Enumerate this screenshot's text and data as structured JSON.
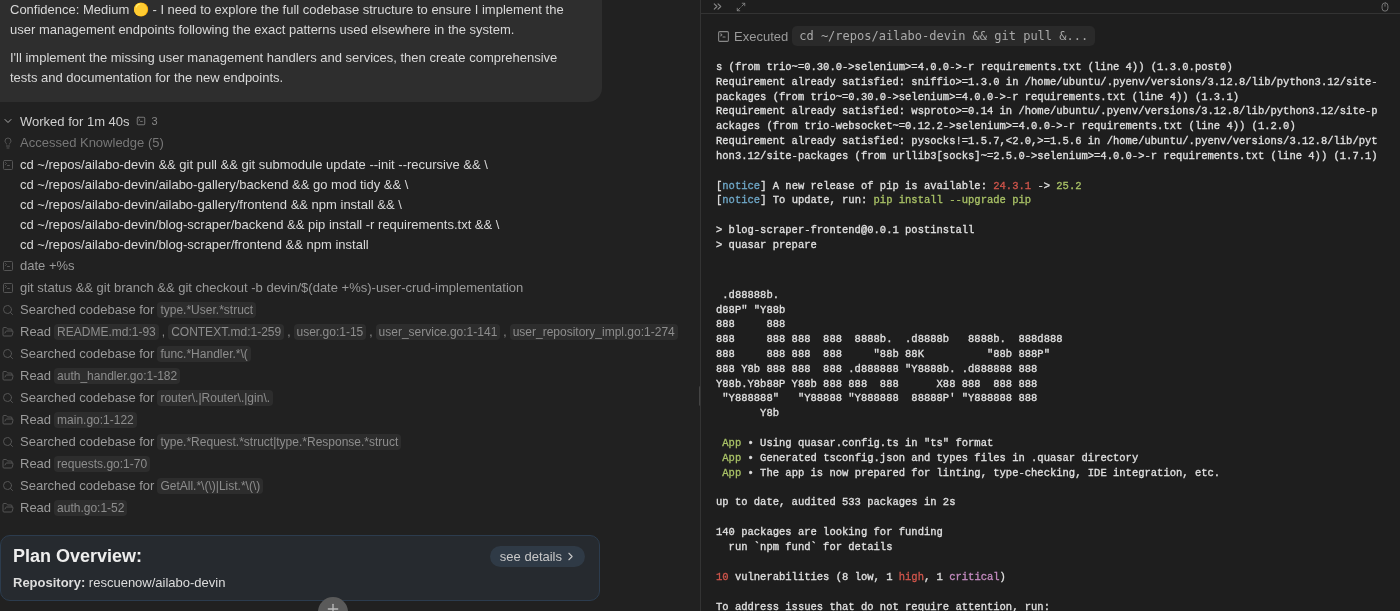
{
  "message": {
    "paragraphs": [
      "Confidence: Medium 🟡 - I need to explore the full codebase structure to ensure I implement the user management endpoints following the exact patterns used elsewhere in the system.",
      "I'll implement the missing user management handlers and services, then create comprehensive tests and documentation for the new endpoints."
    ]
  },
  "worklog": {
    "title": "Worked for 1m 40s",
    "command_count": "3",
    "expanded": true,
    "items": [
      {
        "kind": "knowledge",
        "text": "Accessed Knowledge (5)"
      },
      {
        "kind": "command",
        "lines": [
          "cd ~/repos/ailabo-devin && git pull && git submodule update --init --recursive && \\",
          "cd ~/repos/ailabo-devin/ailabo-gallery/backend && go mod tidy && \\",
          "cd ~/repos/ailabo-devin/ailabo-gallery/frontend && npm install && \\",
          "cd ~/repos/ailabo-devin/blog-scraper/backend && pip install -r requirements.txt && \\",
          "cd ~/repos/ailabo-devin/blog-scraper/frontend && npm install"
        ]
      },
      {
        "kind": "command",
        "lines": [
          "date +%s"
        ]
      },
      {
        "kind": "command",
        "lines": [
          "git status && git branch && git checkout -b devin/$(date +%s)-user-crud-implementation"
        ]
      },
      {
        "kind": "search",
        "text": "Searched codebase for",
        "chips": [
          "type.*User.*struct"
        ]
      },
      {
        "kind": "read",
        "text": "Read",
        "separator": ",",
        "chips": [
          "README.md:1-93",
          "CONTEXT.md:1-259",
          "user.go:1-15",
          "user_service.go:1-141",
          "user_repository_impl.go:1-274"
        ]
      },
      {
        "kind": "search",
        "text": "Searched codebase for",
        "chips": [
          "func.*Handler.*\\("
        ]
      },
      {
        "kind": "read",
        "text": "Read",
        "chips": [
          "auth_handler.go:1-182"
        ]
      },
      {
        "kind": "search",
        "text": "Searched codebase for",
        "chips": [
          "router\\.|Router\\.|gin\\."
        ]
      },
      {
        "kind": "read",
        "text": "Read",
        "chips": [
          "main.go:1-122"
        ]
      },
      {
        "kind": "search",
        "text": "Searched codebase for",
        "chips": [
          "type.*Request.*struct|type.*Response.*struct"
        ]
      },
      {
        "kind": "read",
        "text": "Read",
        "chips": [
          "requests.go:1-70"
        ]
      },
      {
        "kind": "search",
        "text": "Searched codebase for",
        "chips": [
          "GetAll.*\\(\\)|List.*\\(\\)"
        ]
      },
      {
        "kind": "read",
        "text": "Read",
        "chips": [
          "auth.go:1-52"
        ]
      }
    ]
  },
  "plan": {
    "title": "Plan Overview:",
    "details_button": "see details",
    "repository_label": "Repository:",
    "repository": "rescuenow/ailabo-devin"
  },
  "terminal": {
    "executed_label": "Executed",
    "command": "cd ~/repos/ailabo-devin && git pull &...",
    "blocks": [
      {
        "kind": "text",
        "lines": [
          [
            {
              "text": "s (from trio~=0.30.0->selenium>=4.0.0->-r requirements.txt (line 4)) (1.3.0.post0)"
            }
          ],
          [
            {
              "text": "Requirement already satisfied: sniffio>=1.3.0 in /home/ubuntu/.pyenv/versions/3.12.8/lib/python3.12/site-"
            }
          ],
          [
            {
              "text": "packages (from trio~=0.30.0->selenium>=4.0.0->-r requirements.txt (line 4)) (1.3.1)"
            }
          ],
          [
            {
              "text": "Requirement already satisfied: wsproto>=0.14 in /home/ubuntu/.pyenv/versions/3.12.8/lib/python3.12/site-p"
            }
          ],
          [
            {
              "text": "ackages (from trio-websocket~=0.12.2->selenium>=4.0.0->-r requirements.txt (line 4)) (1.2.0)"
            }
          ],
          [
            {
              "text": "Requirement already satisfied: pysocks!=1.5.7,<2.0,>=1.5.6 in /home/ubuntu/.pyenv/versions/3.12.8/lib/pyt"
            }
          ],
          [
            {
              "text": "hon3.12/site-packages (from urllib3[socks]~=2.5.0->selenium>=4.0.0->-r requirements.txt (line 4)) (1.7.1)"
            }
          ]
        ]
      },
      {
        "kind": "text",
        "lines": [
          [
            {
              "text": "["
            },
            {
              "text": "notice",
              "color": "#6fa8c8"
            },
            {
              "text": "] A new release of pip is available: "
            },
            {
              "text": "24.3.1",
              "color": "#d0554b"
            },
            {
              "text": " -> "
            },
            {
              "text": "25.2",
              "color": "#a9c266"
            }
          ],
          [
            {
              "text": "["
            },
            {
              "text": "notice",
              "color": "#6fa8c8"
            },
            {
              "text": "] To update, run: "
            },
            {
              "text": "pip install --upgrade pip",
              "color": "#a9c266"
            }
          ]
        ]
      },
      {
        "kind": "text",
        "lines": [
          [
            {
              "text": "> blog-scraper-frontend@0.0.1 postinstall"
            }
          ],
          [
            {
              "text": "> quasar prepare"
            }
          ]
        ]
      },
      {
        "kind": "ascii",
        "lines": [
          [
            {
              "text": " .d88888b."
            }
          ],
          [
            {
              "text": "d88P\" \"Y88b"
            }
          ],
          [
            {
              "text": "888     888"
            }
          ],
          [
            {
              "text": "888     888 888  888  8888b.  .d8888b   8888b.  888d888"
            }
          ],
          [
            {
              "text": "888     888 888  888     \"88b 88K          \"88b 888P\""
            }
          ],
          [
            {
              "text": "888 Y8b 888 888  888 .d888888 \"Y8888b. .d888888 888"
            }
          ],
          [
            {
              "text": "Y88b.Y8b88P Y88b 888 888  888      X88 888  888 888"
            }
          ],
          [
            {
              "text": " \"Y888888\"   \"Y88888 \"Y888888  88888P' \"Y888888 888"
            }
          ],
          [
            {
              "text": "       Y8b"
            }
          ]
        ]
      },
      {
        "kind": "text",
        "lines": [
          [
            {
              "text": " App",
              "color": "#a9c266"
            },
            {
              "text": " • Using quasar.config.ts in \"ts\" format"
            }
          ],
          [
            {
              "text": " App",
              "color": "#a9c266"
            },
            {
              "text": " • Generated tsconfig.json and types files in .quasar directory"
            }
          ],
          [
            {
              "text": " App",
              "color": "#a9c266"
            },
            {
              "text": " • The app is now prepared for linting, type-checking, IDE integration, etc."
            }
          ]
        ]
      },
      {
        "kind": "text",
        "lines": [
          [
            {
              "text": "up to date, audited 533 packages in 2s"
            }
          ]
        ]
      },
      {
        "kind": "text",
        "lines": [
          [
            {
              "text": "140 packages are looking for funding"
            }
          ],
          [
            {
              "text": "  run `npm fund` for details"
            }
          ]
        ]
      },
      {
        "kind": "text",
        "lines": [
          [
            {
              "text": "10",
              "color": "#d0554b"
            },
            {
              "text": " vulnerabilities (8 low, 1 "
            },
            {
              "text": "high",
              "color": "#d0554b"
            },
            {
              "text": ", 1 "
            },
            {
              "text": "critical",
              "color": "#c48bc0"
            },
            {
              "text": ")"
            }
          ]
        ]
      },
      {
        "kind": "text",
        "lines": [
          [
            {
              "text": "To address issues that do not require attention, run:"
            }
          ]
        ]
      }
    ]
  }
}
